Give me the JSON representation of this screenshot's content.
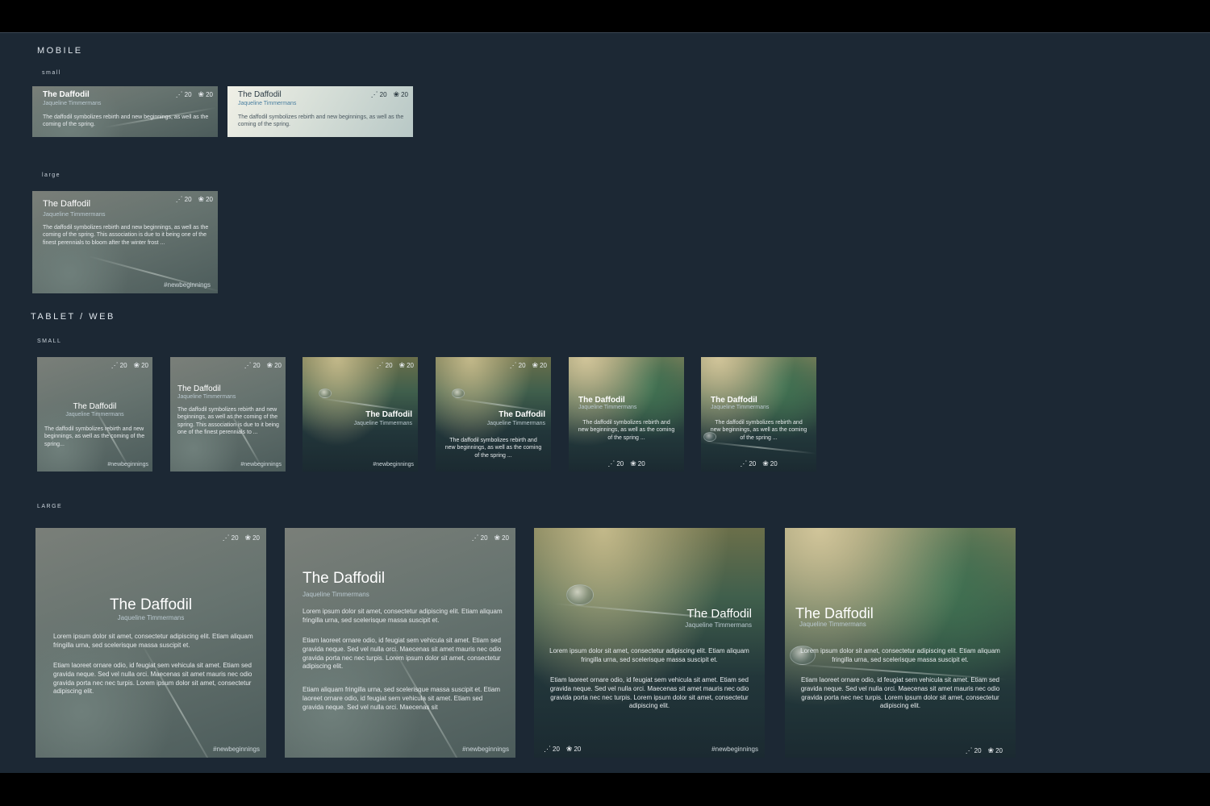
{
  "sections": {
    "mobile": "MOBILE",
    "mobile_small": "small",
    "mobile_large": "large",
    "tablet_web": "TABLET / WEB",
    "tablet_small": "SMALL",
    "tablet_large": "LARGE"
  },
  "card": {
    "title": "The Daffodil",
    "author": "Jaqueline Timmermans",
    "hashtag": "#newbeginnings",
    "shares": "20",
    "likes": "20",
    "share_icon": "share-icon",
    "lotus_icon": "lotus-icon"
  },
  "descriptions": {
    "short": "The daffodil symbolizes rebirth and new beginnings, as well as the coming of the spring.",
    "long": "The daffodil symbolizes rebirth and new beginnings, as well as the coming of the spring.  This association is due to it being one of the finest perennials to bloom after the winter frost ...",
    "small_a": "The daffodil symbolizes rebirth and new beginnings, as well as the coming of the spring...",
    "small_b": "The daffodil symbolizes rebirth and new beginnings, as well as the coming of the spring.  This association is due to it being one of the finest perennials to ...",
    "small_c": "The daffodil symbolizes rebirth and new beginnings, as well as the coming of the spring ..."
  },
  "lorem": {
    "p1": "Lorem ipsum dolor sit amet, consectetur adipiscing elit. Etiam aliquam fringilla urna, sed scelerisque massa suscipit et.",
    "p2": "Etiam laoreet ornare odio, id feugiat sem vehicula sit amet. Etiam sed gravida neque. Sed vel nulla orci. Maecenas sit amet mauris nec odio gravida porta nec nec turpis. Lorem ipsum dolor sit amet, consectetur adipiscing elit.",
    "p3": "Etiam aliquam fringilla urna, sed scelerisque massa suscipit et. Etiam laoreet ornare odio, id feugiat sem vehicula sit amet. Etiam sed gravida neque. Sed vel nulla orci. Maecenas sit"
  },
  "colors": {
    "board": "#1c2834",
    "frame": "#000000",
    "author_accent": "#4a7fa0"
  }
}
